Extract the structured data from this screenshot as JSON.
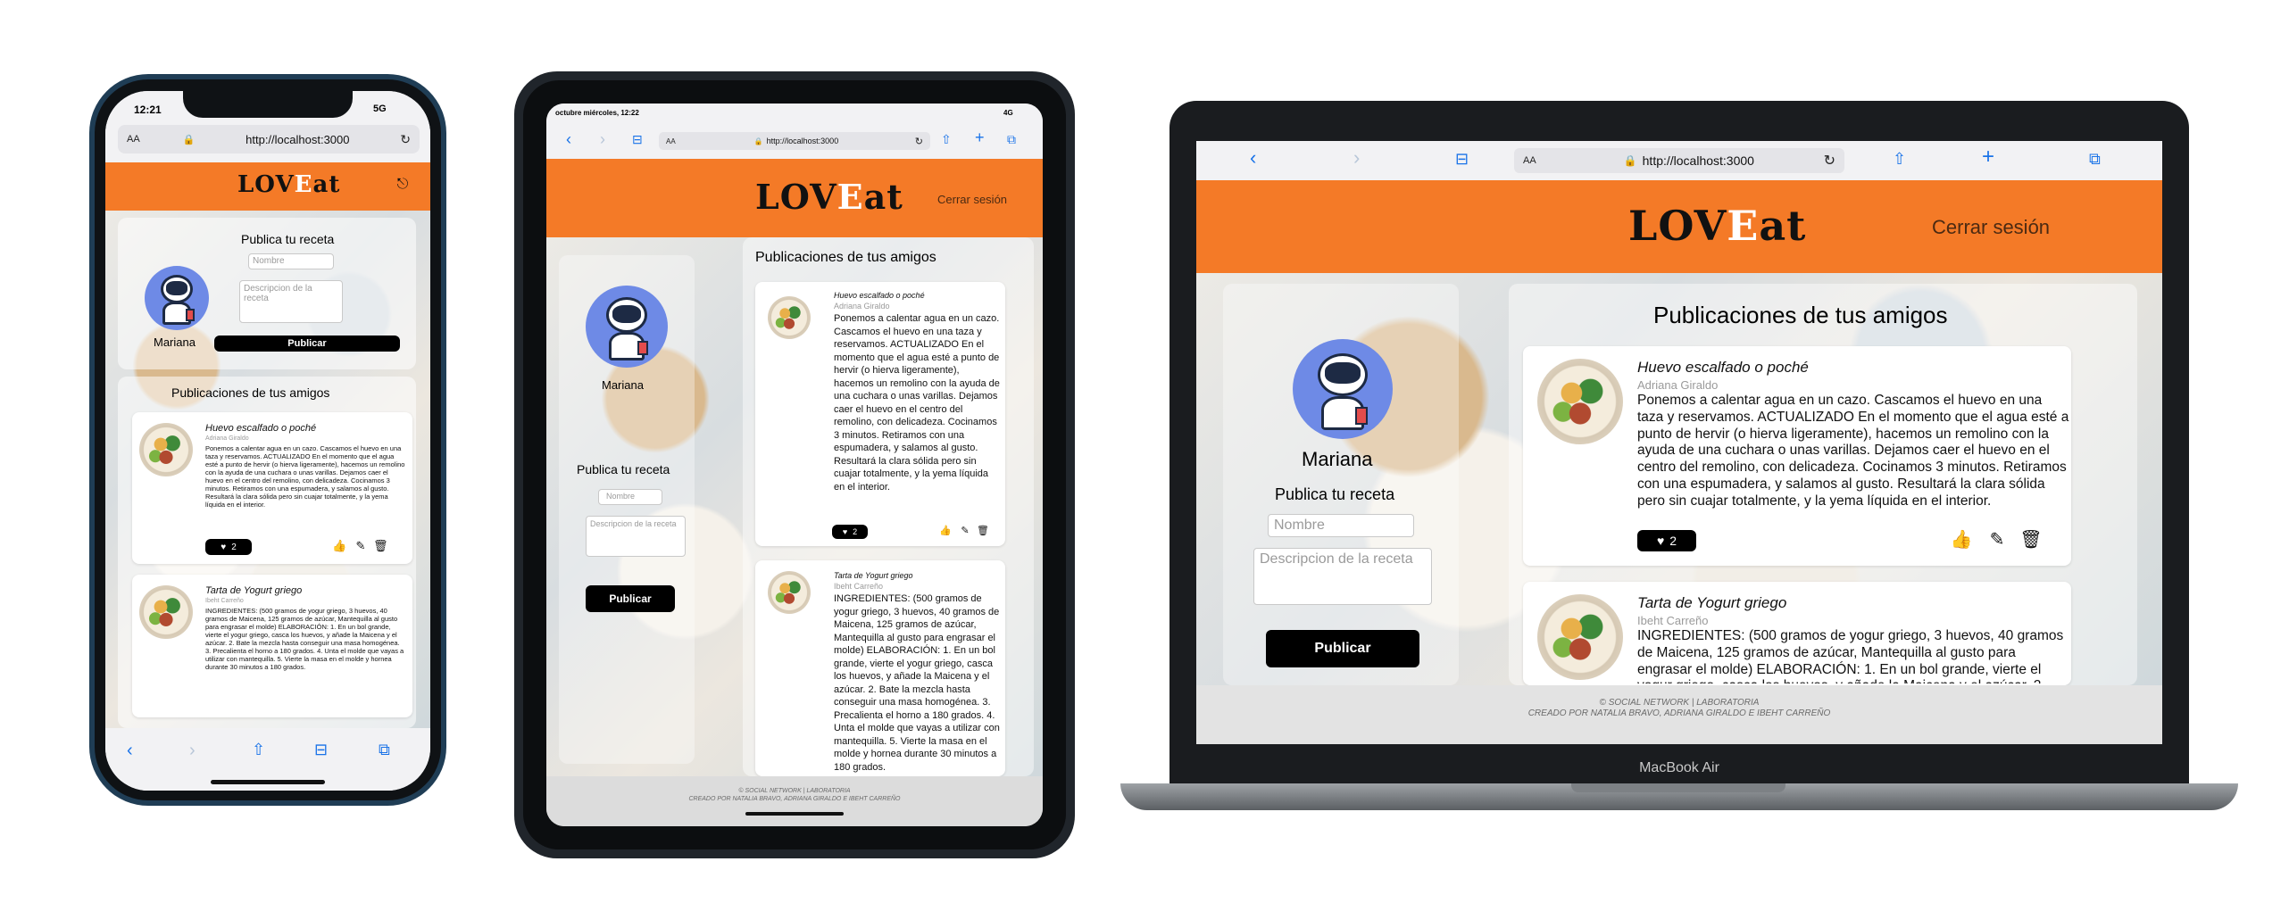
{
  "app": {
    "logo_left": "LOV",
    "logo_c": "E",
    "logo_right": "at",
    "user_name": "Mariana",
    "logout_label": "Cerrar sesión",
    "publish_title": "Publica tu receta",
    "name_placeholder": "Nombre",
    "desc_placeholder": "Descripcion de la receta",
    "publish_button": "Publicar",
    "feed_title": "Publicaciones de tus amigos",
    "posts": [
      {
        "title": "Huevo escalfado o poché",
        "author": "Adriana Giraldo",
        "body": "Ponemos a calentar agua en un cazo. Cascamos el huevo en una taza y reservamos. ACTUALIZADO En el momento que el agua esté a punto de hervir (o hierva ligeramente), hacemos un remolino con la ayuda de una cuchara o unas varillas. Dejamos caer el huevo en el centro del remolino, con delicadeza. Cocinamos 3 minutos. Retiramos con una espumadera, y salamos al gusto. Resultará la clara sólida pero sin cuajar totalmente, y la yema líquida en el interior.",
        "likes": "2"
      },
      {
        "title": "Tarta de Yogurt griego",
        "author": "Ibeht Carreño",
        "body": "INGREDIENTES: (500 gramos de yogur griego, 3 huevos, 40 gramos de Maicena, 125 gramos de azúcar, Mantequilla al gusto para engrasar el molde) ELABORACIÓN: 1. En un bol grande, vierte el yogur griego, casca los huevos, y añade la Maicena y el azúcar. 2. Bate la mezcla hasta conseguir una masa homogénea. 3. Precalienta el horno a 180 grados. 4. Unta el molde que vayas a utilizar con mantequilla. 5. Vierte la masa en el molde y hornea durante 30 minutos a 180 grados.",
        "likes": ""
      }
    ],
    "footer_line1": "© SOCIAL NETWORK | LABORATORIA",
    "footer_line2": "CREADO POR NATALIA BRAVO, ADRIANA GIRALDO E IBEHT CARREÑO"
  },
  "browser": {
    "url": "http://localhost:3000",
    "aa": "AA"
  },
  "phone": {
    "time": "12:21",
    "signal": "5G"
  },
  "tablet": {
    "status_left": "octubre miércoles, 12:22",
    "signal": "4G"
  },
  "laptop": {
    "model": "MacBook Air"
  },
  "colors": {
    "header": "#f47a27",
    "button": "#000000",
    "avatar": "#6e8ae6"
  }
}
